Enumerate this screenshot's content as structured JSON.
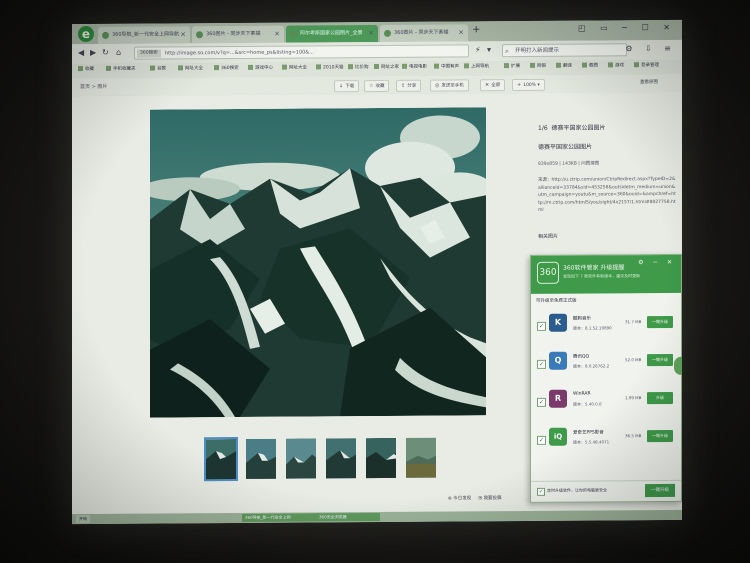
{
  "browser": {
    "logo_letter": "e",
    "tabs": [
      {
        "label": "360导航_新一代安全上网导航"
      },
      {
        "label": "360图片 - 同步天下素描"
      },
      {
        "label": "阿尔卑斯国家公园图片_全景"
      },
      {
        "label": "360图片 - 同步天下素描"
      }
    ],
    "new_tab": "+",
    "url_tag": "360搜索",
    "url": "http://image.so.com/v?q=...&src=home_ps&listing=100&...",
    "search_placeholder": "开明打入新闻提示",
    "bookmarks": [
      "收藏",
      "手机收藏夹",
      "谷歌",
      "网址大全",
      "360搜索",
      "游戏中心",
      "网址大全",
      "2010天猫",
      "比价购",
      "网址之家",
      "电视电影",
      "中国有声",
      "上网导航",
      "扩展",
      "网银",
      "翻译",
      "截图",
      "游戏",
      "登录管理"
    ]
  },
  "toolbar": {
    "breadcrumb": "首页 > 图片",
    "buttons": [
      {
        "icon": "↓",
        "label": "下载"
      },
      {
        "icon": "☆",
        "label": "收藏"
      },
      {
        "icon": "⇪",
        "label": "分享"
      },
      {
        "icon": "◎",
        "label": "发送至手机"
      },
      {
        "icon": "✕",
        "label": "全屏"
      },
      {
        "icon": "+",
        "label": "100%"
      }
    ],
    "right_link": "查看原图"
  },
  "image_info": {
    "counter": "1/6",
    "title": "德赛平国家公园图片",
    "subtitle": "德赛平国家公园图片",
    "meta": "839x859 | 143KB | 问图搜图",
    "source_label": "来源：http://u.ctrip.com/union/CtripRedirect.aspx?TypeID=2&allianceid=33784&sid=453258&outsidetm_medium=union&utm_campaign=youtu&m_source=360&ouid=&ampchref=http://m.ctrip.com/html5/you/sight/4x2157/1.html#8827758.html",
    "related": "相关图片"
  },
  "thumbnails": [
    "thumb-1",
    "thumb-2",
    "thumb-3",
    "thumb-4",
    "thumb-5",
    "thumb-6"
  ],
  "bottom_links": [
    "今日发现",
    "我要投稿"
  ],
  "popup": {
    "logo": "360",
    "title": "360软件管家 升级提醒",
    "subtitle": "发现如下 7 款软件有新版本，建议及时更新",
    "section": "可升级至免费正式版",
    "apps": [
      {
        "icon_letter": "K",
        "name": "酷狗音乐",
        "version": "版本：8.1.52.19890",
        "size": "31.7 MB",
        "button": "一键升级",
        "color": "#2a5c8f"
      },
      {
        "icon_letter": "Q",
        "name": "腾讯QQ",
        "version": "版本：8.0.26762.2",
        "size": "52.0 MB",
        "button": "一键升级",
        "color": "#3a7ab8"
      },
      {
        "icon_letter": "R",
        "name": "WinRAR",
        "version": "版本：5.40.0.0",
        "size": "1.99 MB",
        "button": "升级",
        "color": "#7a3a6a"
      },
      {
        "icon_letter": "iQ",
        "name": "爱奇艺PPS影音",
        "version": "版本：5.5.48.4071",
        "size": "36.5 MB",
        "button": "一键升级",
        "color": "#3f9a4a"
      }
    ],
    "footer_text": "定时升级软件，让你的电脑更安全",
    "footer_button": "一键升级"
  },
  "taskbar": [
    "开始",
    "360导航_新一代安全上网",
    "360安全浏览器"
  ],
  "colors": {
    "accent": "#3f9a4a",
    "selected_thumb": "#4d8cc9"
  }
}
